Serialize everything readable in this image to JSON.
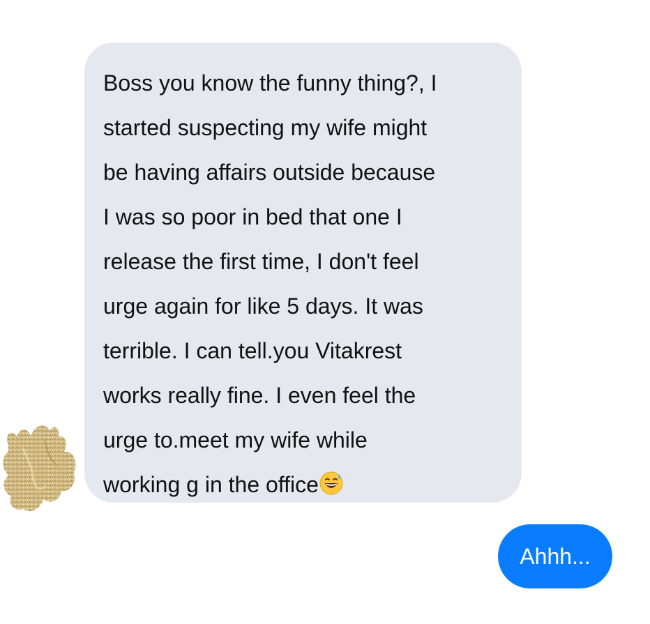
{
  "colors": {
    "incoming_bubble": "#e5e9ef",
    "outgoing_bubble": "#0a7cff",
    "incoming_text": "#111111",
    "outgoing_text": "#ffffff",
    "background": "#ffffff"
  },
  "conversation": {
    "incoming_message": {
      "avatar_icon": "glitter-avatar-icon",
      "lines": [
        "Boss you know the funny thing?, I",
        "started suspecting my wife might",
        "be having affairs outside because",
        "I was so poor in bed that one I",
        "release the first time, I don't feel",
        "urge again for like 5 days. It was",
        "terrible. I can tell.you Vitakrest",
        "works really fine. I even feel the",
        "urge to.meet my wife while",
        "working g in the office"
      ],
      "trailing_emoji": "grinning-face-with-sweat-icon"
    },
    "outgoing_message": {
      "text": "Ahhh..."
    }
  }
}
